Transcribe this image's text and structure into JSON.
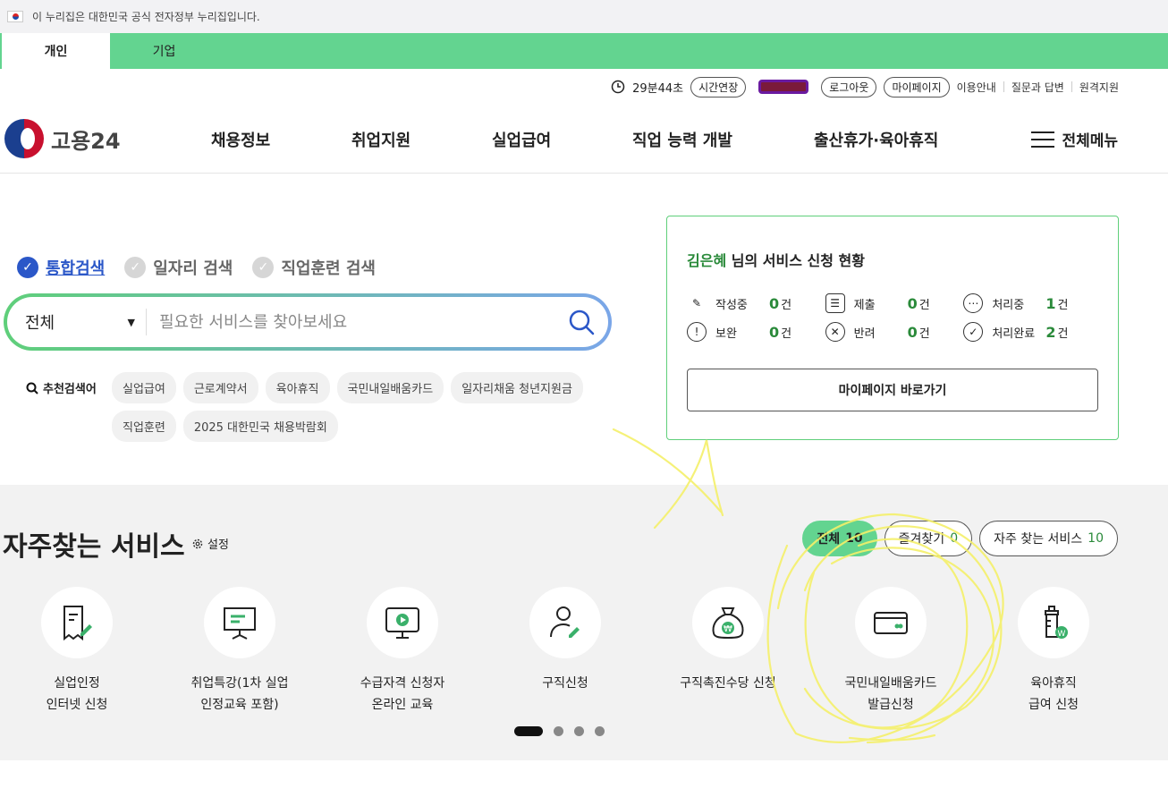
{
  "gov_banner": {
    "text": "이 누리집은 대한민국 공식 전자정부 누리집입니다."
  },
  "top_tabs": [
    {
      "label": "개인"
    },
    {
      "label": "기업"
    }
  ],
  "util": {
    "timer": "29분44초",
    "extend": "시간연장",
    "logout": "로그아웃",
    "mypage": "마이페이지",
    "links": [
      "이용안내",
      "질문과 답변",
      "원격지원"
    ]
  },
  "header": {
    "logo_text": "고용24",
    "nav": [
      "채용정보",
      "취업지원",
      "실업급여",
      "직업 능력 개발",
      "출산휴가·육아휴직"
    ],
    "all_menu": "전체메뉴"
  },
  "search": {
    "tabs": [
      "통합검색",
      "일자리 검색",
      "직업훈련 검색"
    ],
    "scope": "전체",
    "placeholder": "필요한 서비스를 찾아보세요",
    "recommend_label": "추천검색어",
    "recommend": [
      "실업급여",
      "근로계약서",
      "육아휴직",
      "국민내일배움카드",
      "일자리채움 청년지원금",
      "직업훈련",
      "2025 대한민국 채용박람회"
    ]
  },
  "status": {
    "name": "김은혜",
    "title_suffix": "님의 서비스 신청 현황",
    "unit": "건",
    "items": [
      {
        "label": "작성중",
        "count": "0",
        "icon": "pencil-icon"
      },
      {
        "label": "제출",
        "count": "0",
        "icon": "checklist-icon"
      },
      {
        "label": "처리중",
        "count": "1",
        "icon": "ellipsis-icon"
      },
      {
        "label": "보완",
        "count": "0",
        "icon": "exclamation-icon"
      },
      {
        "label": "반려",
        "count": "0",
        "icon": "x-circle-icon"
      },
      {
        "label": "처리완료",
        "count": "2",
        "icon": "check-circle-icon"
      }
    ],
    "button": "마이페이지 바로가기"
  },
  "services": {
    "title": "자주찾는 서비스",
    "setting": "설정",
    "filters": [
      {
        "label": "전체",
        "count": "10"
      },
      {
        "label": "즐겨찾기",
        "count": "0"
      },
      {
        "label": "자주 찾는 서비스",
        "count": "10"
      }
    ],
    "items": [
      {
        "line1": "실업인정",
        "line2": "인터넷 신청",
        "icon": "document-pen-icon"
      },
      {
        "line1": "취업특강(1차 실업",
        "line2": "인정교육 포함)",
        "icon": "presentation-board-icon"
      },
      {
        "line1": "수급자격 신청자",
        "line2": "온라인 교육",
        "icon": "monitor-play-icon"
      },
      {
        "line1": "구직신청",
        "line2": "",
        "icon": "person-pen-icon"
      },
      {
        "line1": "구직촉진수당 신청",
        "line2": "",
        "icon": "money-bag-icon"
      },
      {
        "line1": "국민내일배움카드",
        "line2": "발급신청",
        "icon": "card-icon"
      },
      {
        "line1": "육아휴직",
        "line2": "급여 신청",
        "icon": "baby-bottle-icon"
      }
    ]
  },
  "colors": {
    "brand_green": "#63d490",
    "accent_blue": "#2b57c8",
    "count_green": "#2a8a3a"
  }
}
